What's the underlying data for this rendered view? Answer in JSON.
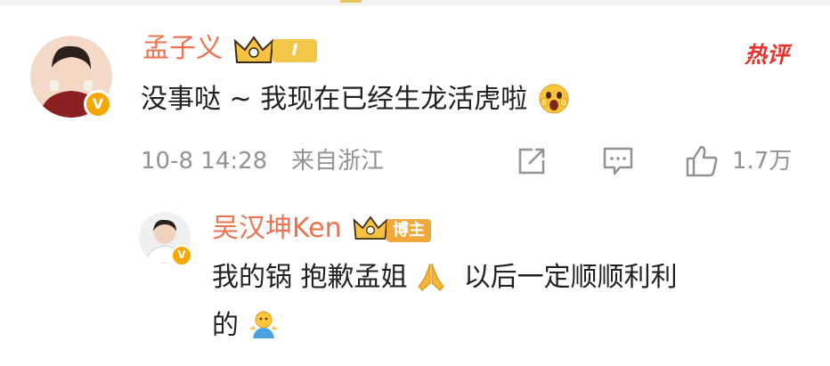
{
  "comment": {
    "author": "孟子义",
    "level_label": "I",
    "hot_label": "热评",
    "text": "没事哒 ~ 我现在已经生龙活虎啦",
    "time": "10-8 14:28",
    "location": "来自浙江",
    "like_count": "1.7万",
    "verified_badge": "V",
    "icons": [
      "crown-icon",
      "share-icon",
      "comment-icon",
      "like-icon",
      "surprised-emoji-icon"
    ]
  },
  "reply": {
    "author": "吴汉坤Ken",
    "role_label": "博主",
    "verified_badge": "V",
    "text_line1": "我的锅 抱歉孟姐",
    "text_line1b": "以后一定顺顺利利",
    "text_line2": "的",
    "icons": [
      "crown-icon",
      "pray-emoji-icon",
      "shrug-emoji-icon"
    ]
  },
  "colors": {
    "username": "#eb7350",
    "hot": "#e8342e",
    "meta": "#939393",
    "text": "#222222",
    "badge_gold": "#f5c242"
  }
}
